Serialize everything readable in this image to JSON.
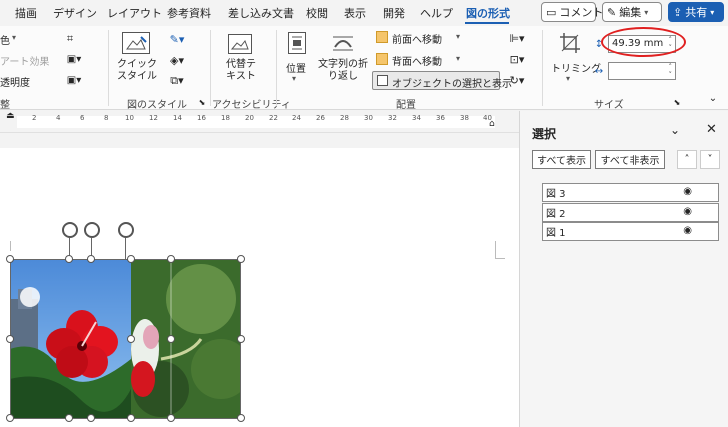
{
  "tabs": [
    "描画",
    "デザイン",
    "レイアウト",
    "参考資料",
    "差し込み文書",
    "校閲",
    "表示",
    "開発",
    "ヘルプ",
    "図の形式"
  ],
  "top_buttons": {
    "comment": "コメント",
    "edit": "編集",
    "share": "共有"
  },
  "ribbon": {
    "left": {
      "item1": "色",
      "item2": "アート効果",
      "item3": "透明度",
      "group": "整"
    },
    "quick_style": "クイック\nスタイル",
    "style_group": "図のスタイル",
    "alt_text": "代替テ\nキスト",
    "access_group": "アクセシビリティ",
    "position": "位置",
    "wrap_text": "文字列の折\nり返し",
    "bring_forward": "前面へ移動",
    "send_backward": "背面へ移動",
    "selection_pane": "オブジェクトの選択と表示",
    "arrange_group": "配置",
    "crop": "トリミング",
    "height_value": "49.39 mm",
    "width_value": "",
    "size_group": "サイズ"
  },
  "ruler_numbers": [
    "2",
    "4",
    "6",
    "8",
    "10",
    "12",
    "14",
    "16",
    "18",
    "20",
    "22",
    "24",
    "26",
    "28",
    "30",
    "32",
    "34",
    "36",
    "38",
    "40"
  ],
  "panel": {
    "title": "選択",
    "show_all": "すべて表示",
    "hide_all": "すべて非表示",
    "items": [
      "図 3",
      "図 2",
      "図 1"
    ]
  },
  "colors": {
    "accent": "#1b5fb3",
    "highlight_circle": "#e02020"
  }
}
